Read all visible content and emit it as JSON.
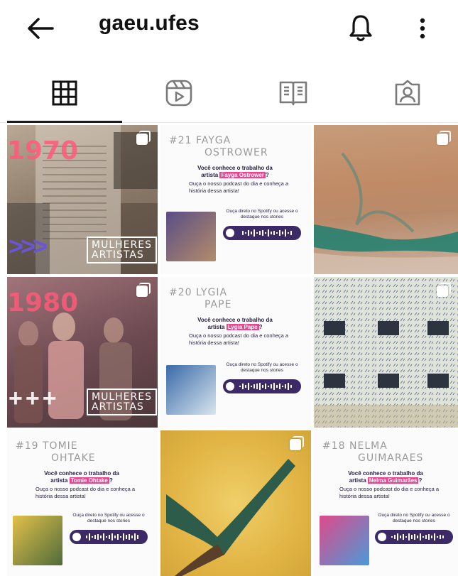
{
  "header": {
    "username": "gaeu.ufes",
    "back_icon": "arrow-left-icon",
    "bell_icon": "bell-icon",
    "menu_icon": "kebab-menu-icon"
  },
  "tabs": [
    {
      "icon": "grid-icon",
      "active": true
    },
    {
      "icon": "reels-icon",
      "active": false
    },
    {
      "icon": "guide-book-icon",
      "active": false
    },
    {
      "icon": "tagged-person-icon",
      "active": false
    }
  ],
  "posts": [
    {
      "kind": "collage",
      "year": "1970",
      "logo_line1": "MULHERES",
      "logo_line2": "ARTISTAS",
      "multi": true
    },
    {
      "kind": "podcast",
      "number": "#21 FAYGA",
      "number2": "OSTROWER",
      "question_a": "Você conhece o trabalho da",
      "question_b": "artista",
      "artist": "Fayga Ostrower",
      "question_end": "?",
      "subtitle": "Ouça o nosso podcast do dia e conheça a história dessa artista!",
      "listen": "Ouça direto no Spotify ou acesse o destaque nos stories",
      "multi": false
    },
    {
      "kind": "painting",
      "multi": true
    },
    {
      "kind": "collage",
      "year": "1980",
      "logo_line1": "MULHERES",
      "logo_line2": "ARTISTAS",
      "multi": true
    },
    {
      "kind": "podcast",
      "number": "#20 LYGIA",
      "number2": "PAPE",
      "question_a": "Você conhece o trabalho da",
      "question_b": "artista",
      "artist": "Lygia Pape",
      "question_end": "?",
      "subtitle": "Ouça o nosso podcast do dia e conheça a história dessa artista!",
      "listen": "Ouça direto no Spotify ou acesse o destaque nos stories",
      "multi": false
    },
    {
      "kind": "painting",
      "multi": true
    },
    {
      "kind": "podcast",
      "number": "#19 TOMIE",
      "number2": "OHTAKE",
      "question_a": "Você conhece o trabalho da",
      "question_b": "artista",
      "artist": "Tomie Ohtake",
      "question_end": "?",
      "subtitle": "Ouça o nosso podcast do dia e conheça a história dessa artista!",
      "listen": "Ouça direto no Spotify ou acesse o destaque nos stories",
      "multi": false
    },
    {
      "kind": "painting",
      "multi": true
    },
    {
      "kind": "podcast",
      "number": "#18 NELMA",
      "number2": "GUIMARAES",
      "question_a": "Você conhece o trabalho da",
      "question_b": "artista",
      "artist": "Nelma Guimarães",
      "question_end": "?",
      "subtitle": "Ouça o nosso podcast do dia e conheça a história dessa artista!",
      "listen": "Ouça direto no Spotify ou acesse o destaque nos stories",
      "multi": false
    }
  ],
  "colors": {
    "accent_pink": "#e8458e",
    "spotify_pill": "#3c2a66",
    "year_red": "#ff5a7a"
  }
}
